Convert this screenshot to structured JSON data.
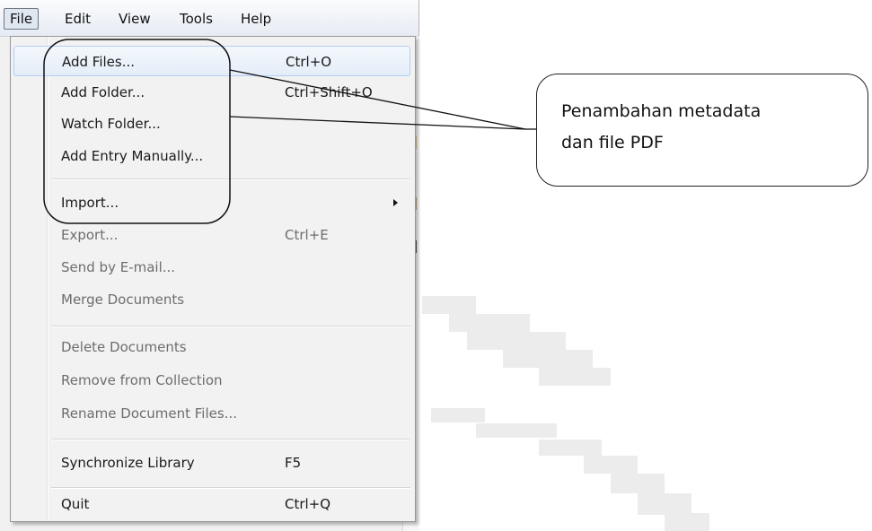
{
  "menubar": {
    "items": [
      {
        "label": "File",
        "active": true
      },
      {
        "label": "Edit"
      },
      {
        "label": "View"
      },
      {
        "label": "Tools"
      },
      {
        "label": "Help"
      }
    ]
  },
  "file_menu": {
    "items": [
      {
        "label": "Add Files...",
        "shortcut": "Ctrl+O",
        "enabled": true,
        "highlighted": true
      },
      {
        "label": "Add Folder...",
        "shortcut": "Ctrl+Shift+O",
        "enabled": true
      },
      {
        "label": "Watch Folder...",
        "shortcut": "",
        "enabled": true
      },
      {
        "label": "Add Entry Manually...",
        "shortcut": "",
        "enabled": true
      },
      {
        "label": "Import...",
        "shortcut": "",
        "enabled": true,
        "submenu": true
      },
      {
        "label": "Export...",
        "shortcut": "Ctrl+E",
        "enabled": false
      },
      {
        "label": "Send by E-mail...",
        "shortcut": "",
        "enabled": false
      },
      {
        "label": "Merge Documents",
        "shortcut": "",
        "enabled": false
      },
      {
        "label": "Delete Documents",
        "shortcut": "",
        "enabled": false
      },
      {
        "label": "Remove from Collection",
        "shortcut": "",
        "enabled": false
      },
      {
        "label": "Rename Document Files...",
        "shortcut": "",
        "enabled": false
      },
      {
        "label": "Synchronize Library",
        "shortcut": "F5",
        "enabled": true
      },
      {
        "label": "Quit",
        "shortcut": "Ctrl+Q",
        "enabled": true
      }
    ]
  },
  "annotation": {
    "callout_text": "Penambahan metadata\ndan file PDF"
  },
  "colors": {
    "menu_bg": "#f2f2f2",
    "highlight_border": "#aecff7",
    "disabled_text": "#6d6d6d"
  }
}
